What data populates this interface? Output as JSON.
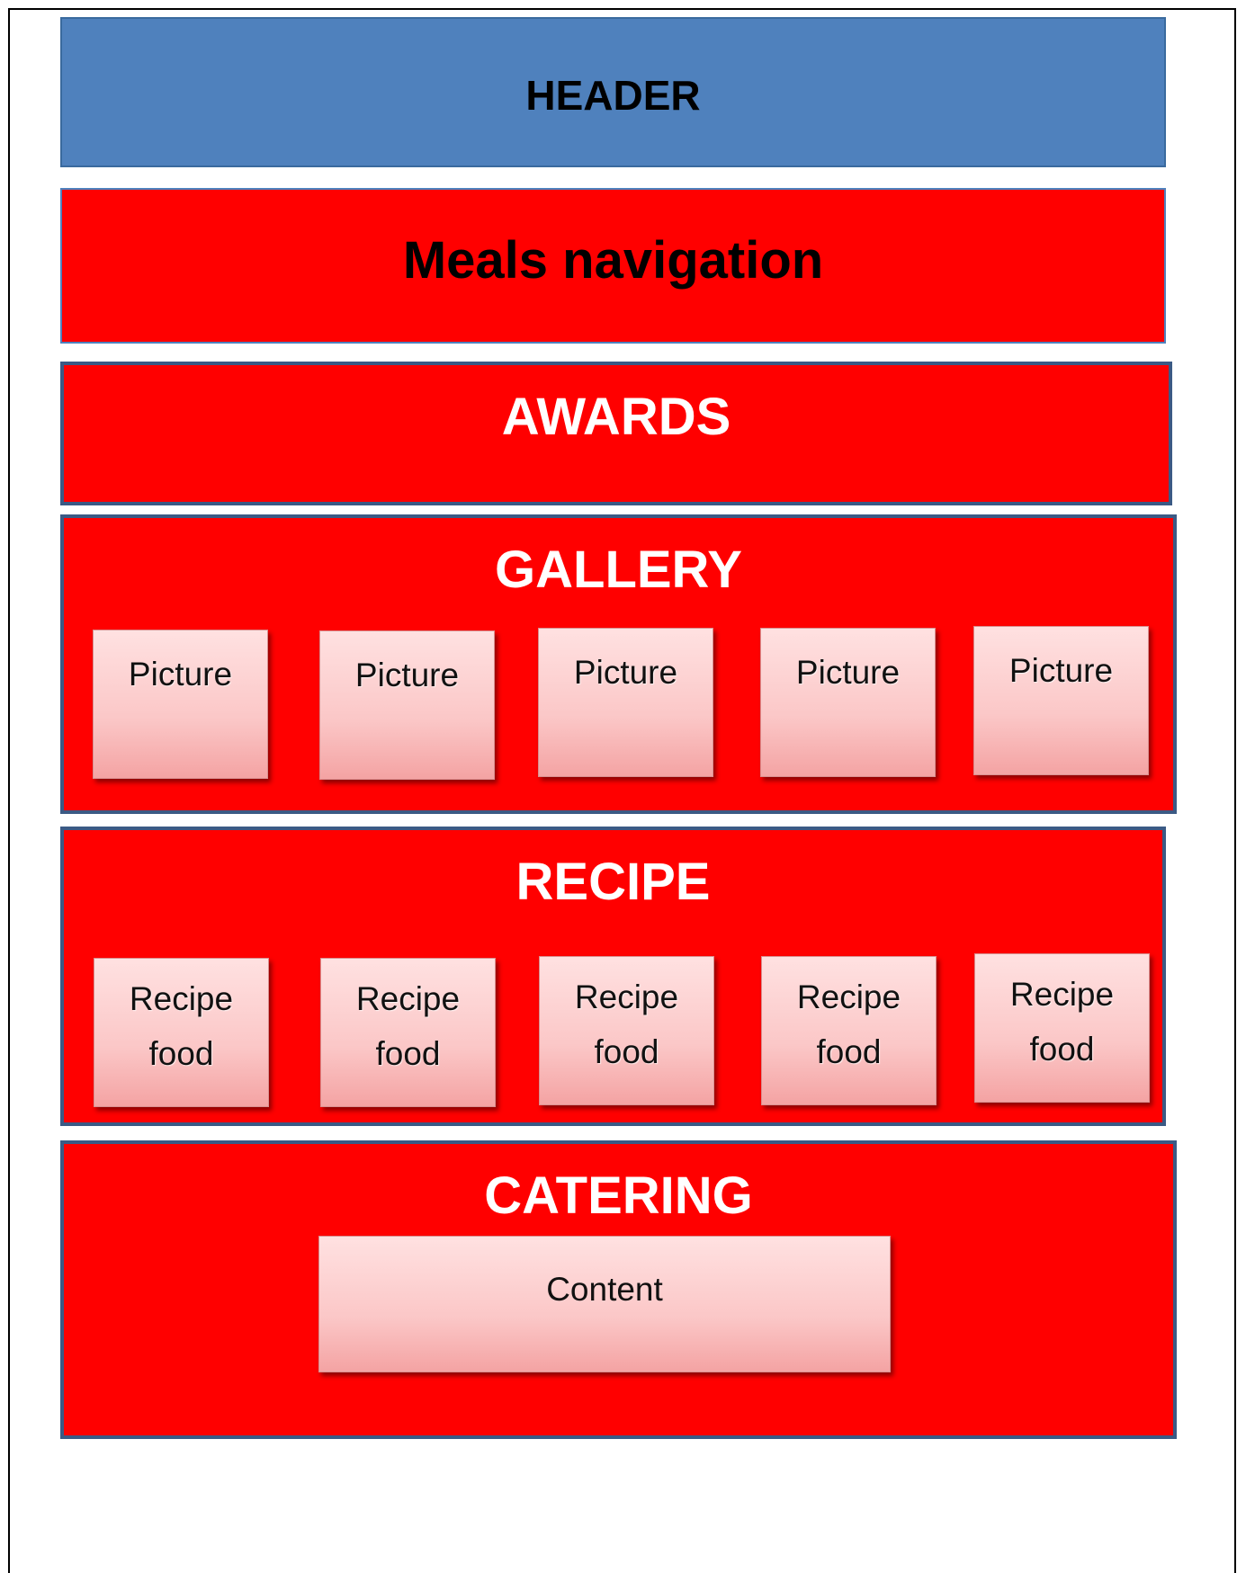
{
  "header": {
    "title": "HEADER"
  },
  "navigation": {
    "title": "Meals navigation"
  },
  "awards": {
    "title": "AWARDS"
  },
  "gallery": {
    "title": "GALLERY",
    "items": [
      "Picture",
      "Picture",
      "Picture",
      "Picture",
      "Picture"
    ]
  },
  "recipe": {
    "title": "RECIPE",
    "items": [
      {
        "line1": "Recipe",
        "line2": "food"
      },
      {
        "line1": "Recipe",
        "line2": "food"
      },
      {
        "line1": "Recipe",
        "line2": "food"
      },
      {
        "line1": "Recipe",
        "line2": "food"
      },
      {
        "line1": "Recipe",
        "line2": "food"
      }
    ]
  },
  "catering": {
    "title": "CATERING",
    "content": "Content"
  },
  "colors": {
    "header": "#4f81bd",
    "section": "#ff0000",
    "section_border": "#3b5a85",
    "card_top": "#ffe1e1",
    "card_bottom": "#f4a3a3"
  }
}
